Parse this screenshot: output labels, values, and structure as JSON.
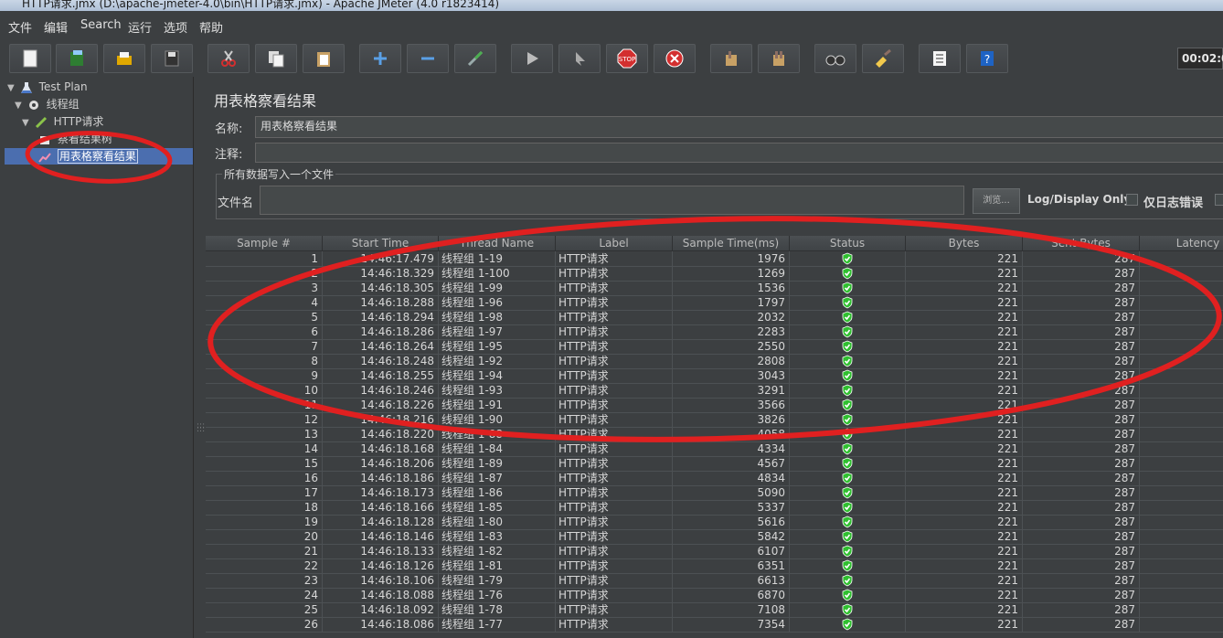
{
  "window": {
    "title": "HTTP请求.jmx (D:\\apache-jmeter-4.0\\bin\\HTTP请求.jmx) - Apache JMeter (4.0 r1823414)"
  },
  "menu": [
    "文件",
    "编辑",
    "Search",
    "运行",
    "选项",
    "帮助"
  ],
  "toolbar": {
    "buttons": [
      "new-icon",
      "templates-icon",
      "open-icon",
      "save-icon",
      "cut-icon",
      "copy-icon",
      "paste-icon",
      "expand-icon",
      "collapse-icon",
      "toggle-icon",
      "start-icon",
      "start-no-pause-icon",
      "stop-icon",
      "shutdown-icon",
      "clear-icon",
      "clear-all-icon",
      "search-icon",
      "reset-search-icon",
      "function-helper-icon",
      "help-icon"
    ],
    "timer": "00:02:0"
  },
  "tree": {
    "items": [
      {
        "label": "Test Plan",
        "icon": "flask-icon"
      },
      {
        "label": "线程组",
        "icon": "gear-icon"
      },
      {
        "label": "HTTP请求",
        "icon": "pipette-icon"
      },
      {
        "label": "察看结果树",
        "icon": "chart-icon"
      },
      {
        "label": "用表格察看结果",
        "icon": "chart-icon"
      }
    ]
  },
  "panel": {
    "title": "用表格察看结果",
    "name_label": "名称:",
    "name_value": "用表格察看结果",
    "comment_label": "注释:",
    "comment_value": "",
    "file_group_title": "所有数据写入一个文件",
    "filename_label": "文件名",
    "filename_value": "",
    "browse_label": "浏览...",
    "log_display_label": "Log/Display Only:",
    "errors_only_label": "仅日志错误"
  },
  "table": {
    "columns": [
      "Sample #",
      "Start Time",
      "Thread Name",
      "Label",
      "Sample Time(ms)",
      "Status",
      "Bytes",
      "Sent Bytes",
      "Latency"
    ],
    "rows": [
      [
        "1",
        "14:46:17.479",
        "线程组 1-19",
        "HTTP请求",
        "1976",
        "success",
        "221",
        "287"
      ],
      [
        "2",
        "14:46:18.329",
        "线程组 1-100",
        "HTTP请求",
        "1269",
        "success",
        "221",
        "287"
      ],
      [
        "3",
        "14:46:18.305",
        "线程组 1-99",
        "HTTP请求",
        "1536",
        "success",
        "221",
        "287"
      ],
      [
        "4",
        "14:46:18.288",
        "线程组 1-96",
        "HTTP请求",
        "1797",
        "success",
        "221",
        "287"
      ],
      [
        "5",
        "14:46:18.294",
        "线程组 1-98",
        "HTTP请求",
        "2032",
        "success",
        "221",
        "287"
      ],
      [
        "6",
        "14:46:18.286",
        "线程组 1-97",
        "HTTP请求",
        "2283",
        "success",
        "221",
        "287"
      ],
      [
        "7",
        "14:46:18.264",
        "线程组 1-95",
        "HTTP请求",
        "2550",
        "success",
        "221",
        "287"
      ],
      [
        "8",
        "14:46:18.248",
        "线程组 1-92",
        "HTTP请求",
        "2808",
        "success",
        "221",
        "287"
      ],
      [
        "9",
        "14:46:18.255",
        "线程组 1-94",
        "HTTP请求",
        "3043",
        "success",
        "221",
        "287"
      ],
      [
        "10",
        "14:46:18.246",
        "线程组 1-93",
        "HTTP请求",
        "3291",
        "success",
        "221",
        "287"
      ],
      [
        "11",
        "14:46:18.226",
        "线程组 1-91",
        "HTTP请求",
        "3566",
        "success",
        "221",
        "287"
      ],
      [
        "12",
        "14:46:18.216",
        "线程组 1-90",
        "HTTP请求",
        "3826",
        "success",
        "221",
        "287"
      ],
      [
        "13",
        "14:46:18.220",
        "线程组 1-88",
        "HTTP请求",
        "4058",
        "success",
        "221",
        "287"
      ],
      [
        "14",
        "14:46:18.168",
        "线程组 1-84",
        "HTTP请求",
        "4334",
        "success",
        "221",
        "287"
      ],
      [
        "15",
        "14:46:18.206",
        "线程组 1-89",
        "HTTP请求",
        "4567",
        "success",
        "221",
        "287"
      ],
      [
        "16",
        "14:46:18.186",
        "线程组 1-87",
        "HTTP请求",
        "4834",
        "success",
        "221",
        "287"
      ],
      [
        "17",
        "14:46:18.173",
        "线程组 1-86",
        "HTTP请求",
        "5090",
        "success",
        "221",
        "287"
      ],
      [
        "18",
        "14:46:18.166",
        "线程组 1-85",
        "HTTP请求",
        "5337",
        "success",
        "221",
        "287"
      ],
      [
        "19",
        "14:46:18.128",
        "线程组 1-80",
        "HTTP请求",
        "5616",
        "success",
        "221",
        "287"
      ],
      [
        "20",
        "14:46:18.146",
        "线程组 1-83",
        "HTTP请求",
        "5842",
        "success",
        "221",
        "287"
      ],
      [
        "21",
        "14:46:18.133",
        "线程组 1-82",
        "HTTP请求",
        "6107",
        "success",
        "221",
        "287"
      ],
      [
        "22",
        "14:46:18.126",
        "线程组 1-81",
        "HTTP请求",
        "6351",
        "success",
        "221",
        "287"
      ],
      [
        "23",
        "14:46:18.106",
        "线程组 1-79",
        "HTTP请求",
        "6613",
        "success",
        "221",
        "287"
      ],
      [
        "24",
        "14:46:18.088",
        "线程组 1-76",
        "HTTP请求",
        "6870",
        "success",
        "221",
        "287"
      ],
      [
        "25",
        "14:46:18.092",
        "线程组 1-78",
        "HTTP请求",
        "7108",
        "success",
        "221",
        "287"
      ],
      [
        "26",
        "14:46:18.086",
        "线程组 1-77",
        "HTTP请求",
        "7354",
        "success",
        "221",
        "287"
      ]
    ]
  },
  "colors": {
    "background": "#3c3f41",
    "selection": "#4b6eaf",
    "annotation": "#e02020",
    "status_ok": "#2fbf2f"
  }
}
